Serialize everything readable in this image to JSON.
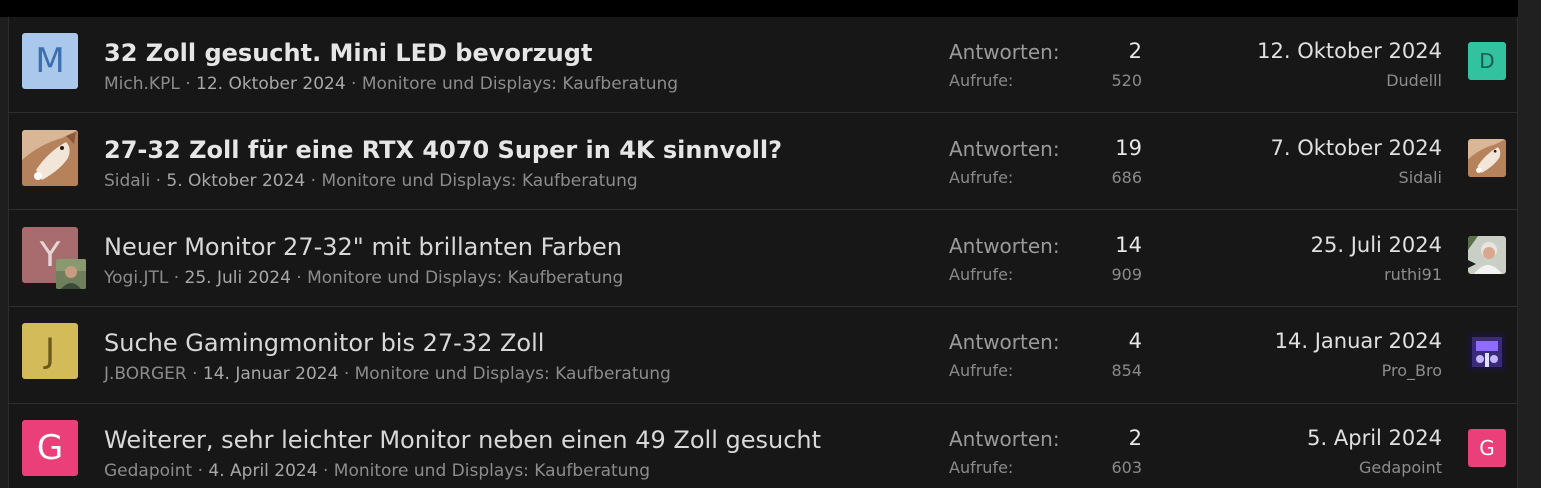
{
  "threads": [
    {
      "title": "32 Zoll gesucht. Mini LED bevorzugt",
      "unread": true,
      "author": "Mich.KPL",
      "date": "12. Oktober 2024",
      "forum": "Monitore und Displays: Kaufberatung",
      "avatar_letter": "M",
      "avatar_bg": "#a9c8ec",
      "avatar_fg": "#3d6fae",
      "replies_label": "Antworten:",
      "replies": "2",
      "views_label": "Aufrufe:",
      "views": "520",
      "last_date": "12. Oktober 2024",
      "last_user": "Dudelll",
      "last_avatar_letter": "D",
      "last_avatar_bg": "#33c2a0",
      "last_avatar_fg": "#1a5c4d"
    },
    {
      "title": "27-32 Zoll für eine RTX 4070 Super in 4K sinnvoll?",
      "unread": true,
      "author": "Sidali",
      "date": "5. Oktober 2024",
      "forum": "Monitore und Displays: Kaufberatung",
      "replies_label": "Antworten:",
      "replies": "19",
      "views_label": "Aufrufe:",
      "views": "686",
      "last_date": "7. Oktober 2024",
      "last_user": "Sidali"
    },
    {
      "title": "Neuer Monitor 27-32\" mit brillanten Farben",
      "unread": false,
      "author": "Yogi.JTL",
      "date": "25. Juli 2024",
      "forum": "Monitore und Displays: Kaufberatung",
      "avatar_letter": "Y",
      "avatar_bg": "#a86c6e",
      "avatar_fg": "#e8d6d6",
      "replies_label": "Antworten:",
      "replies": "14",
      "views_label": "Aufrufe:",
      "views": "909",
      "last_date": "25. Juli 2024",
      "last_user": "ruthi91"
    },
    {
      "title": "Suche Gamingmonitor bis 27-32 Zoll",
      "unread": false,
      "author": "J.BORGER",
      "date": "14. Januar 2024",
      "forum": "Monitore und Displays: Kaufberatung",
      "avatar_letter": "J",
      "avatar_bg": "#d4bb5a",
      "avatar_fg": "#6b5a1c",
      "replies_label": "Antworten:",
      "replies": "4",
      "views_label": "Aufrufe:",
      "views": "854",
      "last_date": "14. Januar 2024",
      "last_user": "Pro_Bro"
    },
    {
      "title": "Weiterer, sehr leichter Monitor neben einen 49 Zoll gesucht",
      "unread": false,
      "author": "Gedapoint",
      "date": "4. April 2024",
      "forum": "Monitore und Displays: Kaufberatung",
      "avatar_letter": "G",
      "avatar_bg": "#ea3f78",
      "avatar_fg": "#ffffff",
      "replies_label": "Antworten:",
      "replies": "2",
      "views_label": "Aufrufe:",
      "views": "603",
      "last_date": "5. April 2024",
      "last_user": "Gedapoint",
      "last_avatar_letter": "G",
      "last_avatar_bg": "#ea3f78",
      "last_avatar_fg": "#ffffff"
    }
  ]
}
